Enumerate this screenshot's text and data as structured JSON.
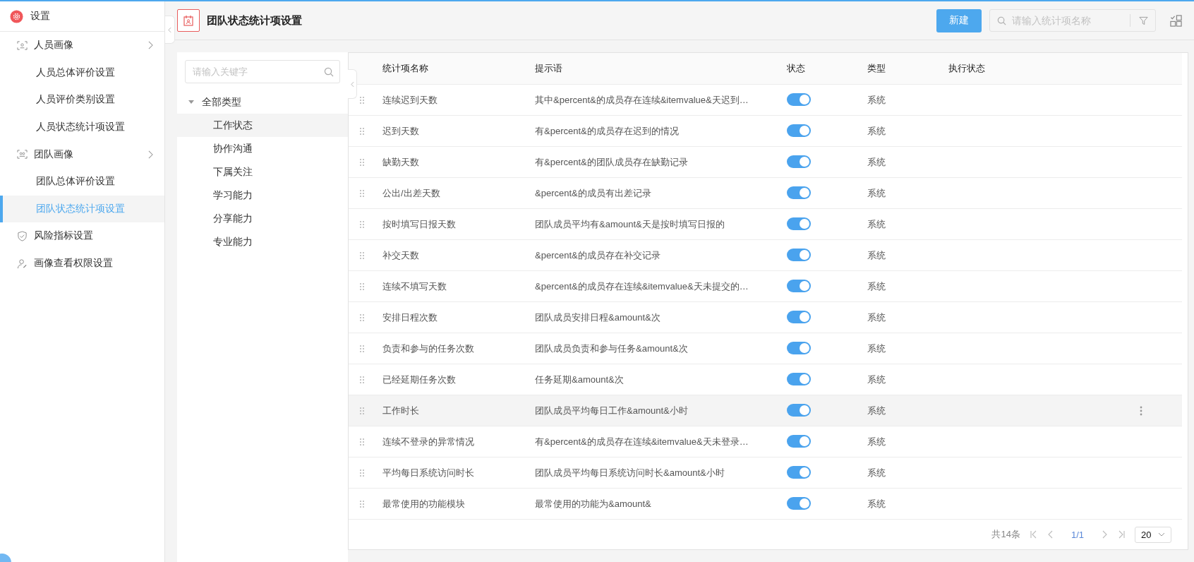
{
  "sidebar": {
    "title": "设置",
    "items": [
      {
        "label": "人员画像",
        "kind": "group",
        "selected": false,
        "children": [
          {
            "label": "人员总体评价设置",
            "selected": false
          },
          {
            "label": "人员评价类别设置",
            "selected": false
          },
          {
            "label": "人员状态统计项设置",
            "selected": false
          }
        ]
      },
      {
        "label": "团队画像",
        "kind": "group",
        "selected": false,
        "children": [
          {
            "label": "团队总体评价设置",
            "selected": false
          },
          {
            "label": "团队状态统计项设置",
            "selected": true
          }
        ]
      },
      {
        "label": "风险指标设置",
        "kind": "item",
        "selected": false
      },
      {
        "label": "画像查看权限设置",
        "kind": "item",
        "selected": false
      }
    ]
  },
  "header": {
    "title": "团队状态统计项设置",
    "new_button": "新建",
    "search": {
      "placeholder": "请输入统计项名称"
    }
  },
  "tree": {
    "search": {
      "placeholder": "请输入关键字"
    },
    "root": {
      "label": "全部类型",
      "expanded": true,
      "children": [
        {
          "label": "工作状态",
          "selected": true
        },
        {
          "label": "协作沟通",
          "selected": false
        },
        {
          "label": "下属关注",
          "selected": false
        },
        {
          "label": "学习能力",
          "selected": false
        },
        {
          "label": "分享能力",
          "selected": false
        },
        {
          "label": "专业能力",
          "selected": false
        }
      ]
    }
  },
  "table": {
    "columns": [
      "统计项名称",
      "提示语",
      "状态",
      "类型",
      "执行状态"
    ],
    "rows": [
      {
        "name": "连续迟到天数",
        "hint": "其中&percent&的成员存在连续&itemvalue&天迟到…",
        "on": true,
        "type": "系统",
        "hovered": false
      },
      {
        "name": "迟到天数",
        "hint": "有&percent&的成员存在迟到的情况",
        "on": true,
        "type": "系统",
        "hovered": false
      },
      {
        "name": "缺勤天数",
        "hint": "有&percent&的团队成员存在缺勤记录",
        "on": true,
        "type": "系统",
        "hovered": false
      },
      {
        "name": "公出/出差天数",
        "hint": "&percent&的成员有出差记录",
        "on": true,
        "type": "系统",
        "hovered": false
      },
      {
        "name": "按时填写日报天数",
        "hint": "团队成员平均有&amount&天是按时填写日报的",
        "on": true,
        "type": "系统",
        "hovered": false
      },
      {
        "name": "补交天数",
        "hint": "&percent&的成员存在补交记录",
        "on": true,
        "type": "系统",
        "hovered": false
      },
      {
        "name": "连续不填写天数",
        "hint": "&percent&的成员存在连续&itemvalue&天未提交的…",
        "on": true,
        "type": "系统",
        "hovered": false
      },
      {
        "name": "安排日程次数",
        "hint": "团队成员安排日程&amount&次",
        "on": true,
        "type": "系统",
        "hovered": false
      },
      {
        "name": "负责和参与的任务次数",
        "hint": "团队成员负责和参与任务&amount&次",
        "on": true,
        "type": "系统",
        "hovered": false
      },
      {
        "name": "已经延期任务次数",
        "hint": "任务延期&amount&次",
        "on": true,
        "type": "系统",
        "hovered": false
      },
      {
        "name": "工作时长",
        "hint": "团队成员平均每日工作&amount&小时",
        "on": true,
        "type": "系统",
        "hovered": true
      },
      {
        "name": "连续不登录的异常情况",
        "hint": "有&percent&的成员存在连续&itemvalue&天未登录…",
        "on": true,
        "type": "系统",
        "hovered": false
      },
      {
        "name": "平均每日系统访问时长",
        "hint": "团队成员平均每日系统访问时长&amount&小时",
        "on": true,
        "type": "系统",
        "hovered": false
      },
      {
        "name": "最常使用的功能模块",
        "hint": "最常使用的功能为&amount&",
        "on": true,
        "type": "系统",
        "hovered": false
      }
    ]
  },
  "pagination": {
    "total": "共14条",
    "page": "1/1",
    "page_size": "20"
  }
}
